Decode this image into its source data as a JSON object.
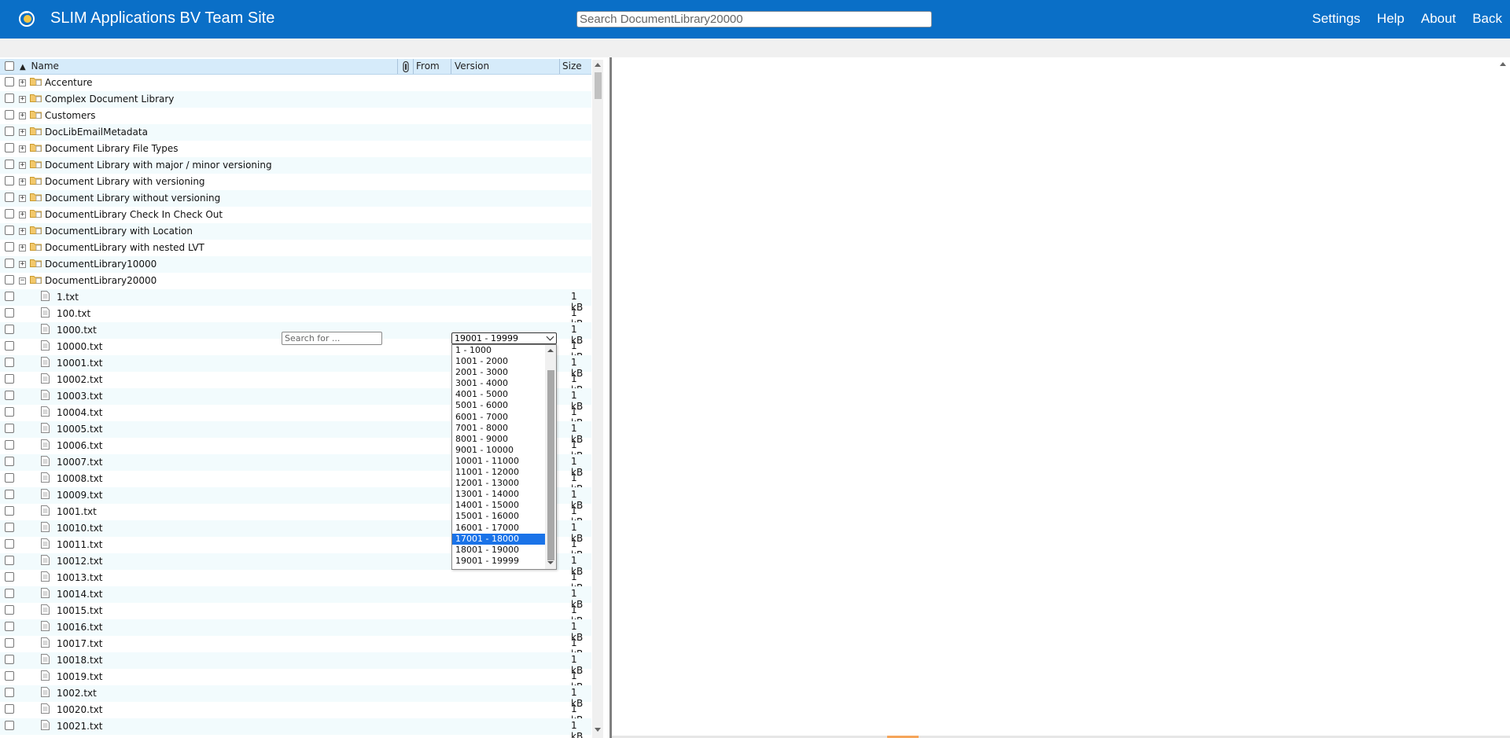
{
  "header": {
    "title": "SLIM Applications BV Team Site",
    "search_placeholder": "Search DocumentLibrary20000",
    "nav": [
      "Settings",
      "Help",
      "About",
      "Back"
    ],
    "brand_color": "#0a6fc7"
  },
  "columns": {
    "name": "Name",
    "attach_icon": "paperclip-icon",
    "from": "From",
    "version": "Version",
    "size": "Size",
    "sort": "ascending"
  },
  "folders": [
    "Accenture",
    "Complex Document Library",
    "Customers",
    "DocLibEmailMetadata",
    "Document Library File Types",
    "Document Library with major / minor versioning",
    "Document Library with versioning",
    "Document Library without versioning",
    "DocumentLibrary Check In Check Out",
    "DocumentLibrary with Location",
    "DocumentLibrary with nested LVT",
    "DocumentLibrary10000"
  ],
  "expanded_folder": {
    "name": "DocumentLibrary20000",
    "search_placeholder": "Search for ...",
    "version_selected": "19001 - 19999"
  },
  "files": [
    {
      "name": "1.txt",
      "size": "1 kB"
    },
    {
      "name": "100.txt",
      "size": "1 kB"
    },
    {
      "name": "1000.txt",
      "size": "1 kB"
    },
    {
      "name": "10000.txt",
      "size": "1 kB"
    },
    {
      "name": "10001.txt",
      "size": "1 kB"
    },
    {
      "name": "10002.txt",
      "size": "1 kB"
    },
    {
      "name": "10003.txt",
      "size": "1 kB"
    },
    {
      "name": "10004.txt",
      "size": "1 kB"
    },
    {
      "name": "10005.txt",
      "size": "1 kB"
    },
    {
      "name": "10006.txt",
      "size": "1 kB"
    },
    {
      "name": "10007.txt",
      "size": "1 kB"
    },
    {
      "name": "10008.txt",
      "size": "1 kB"
    },
    {
      "name": "10009.txt",
      "size": "1 kB"
    },
    {
      "name": "1001.txt",
      "size": "1 kB"
    },
    {
      "name": "10010.txt",
      "size": "1 kB"
    },
    {
      "name": "10011.txt",
      "size": "1 kB"
    },
    {
      "name": "10012.txt",
      "size": "1 kB"
    },
    {
      "name": "10013.txt",
      "size": "1 kB"
    },
    {
      "name": "10014.txt",
      "size": "1 kB"
    },
    {
      "name": "10015.txt",
      "size": "1 kB"
    },
    {
      "name": "10016.txt",
      "size": "1 kB"
    },
    {
      "name": "10017.txt",
      "size": "1 kB"
    },
    {
      "name": "10018.txt",
      "size": "1 kB"
    },
    {
      "name": "10019.txt",
      "size": "1 kB"
    },
    {
      "name": "1002.txt",
      "size": "1 kB"
    },
    {
      "name": "10020.txt",
      "size": "1 kB"
    },
    {
      "name": "10021.txt",
      "size": "1 kB"
    }
  ],
  "version_options": [
    "1 - 1000",
    "1001 - 2000",
    "2001 - 3000",
    "3001 - 4000",
    "4001 - 5000",
    "5001 - 6000",
    "6001 - 7000",
    "7001 - 8000",
    "8001 - 9000",
    "9001 - 10000",
    "10001 - 11000",
    "11001 - 12000",
    "12001 - 13000",
    "13001 - 14000",
    "14001 - 15000",
    "15001 - 16000",
    "16001 - 17000",
    "17001 - 18000",
    "18001 - 19000",
    "19001 - 19999"
  ],
  "version_highlighted": "17001 - 18000"
}
